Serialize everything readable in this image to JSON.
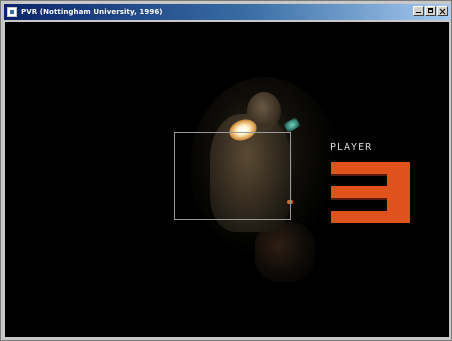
{
  "window": {
    "title": "PVR (Nottingham University, 1996)"
  },
  "game": {
    "player_label": "PLAYER",
    "player_number": "3",
    "colors": {
      "background": "#000000",
      "number": "#e0521c",
      "frame": "#9a9a9a",
      "label": "#d8d8d8"
    }
  }
}
